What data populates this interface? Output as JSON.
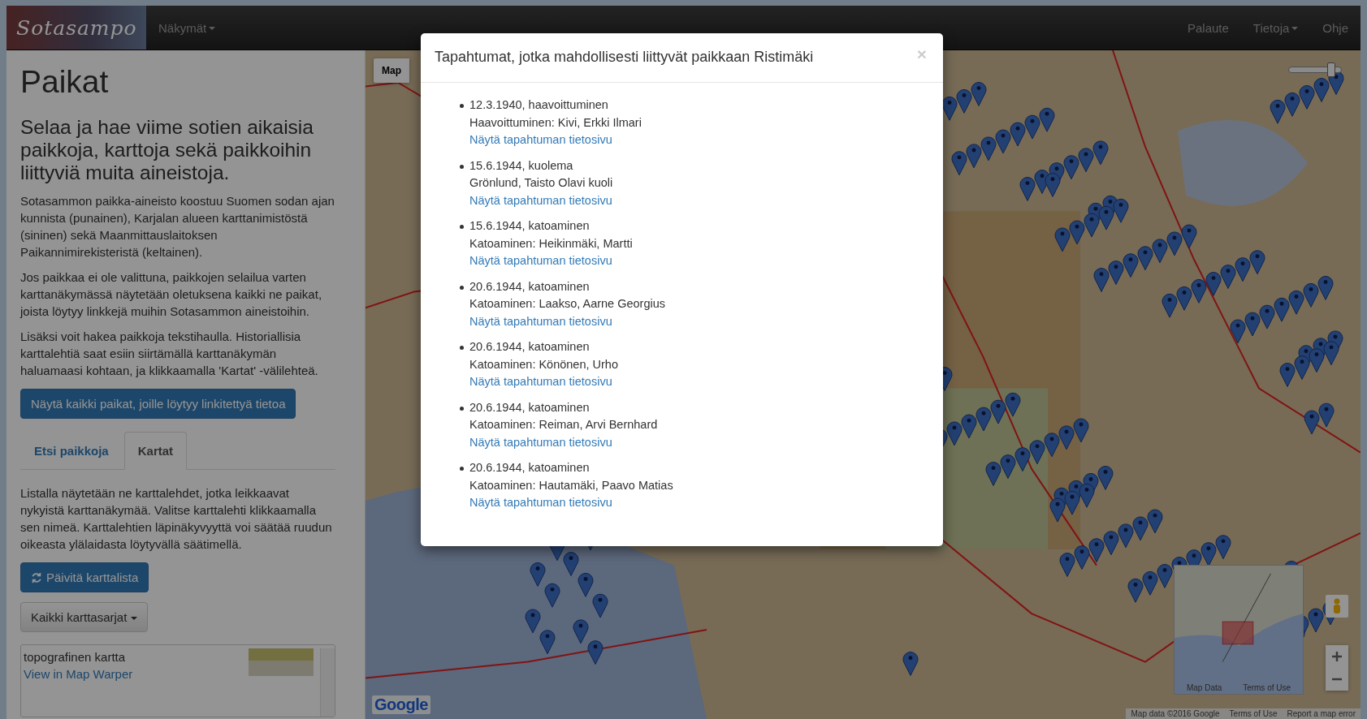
{
  "navbar": {
    "logo": "Sotasampo",
    "menu_left": [
      {
        "label": "Näkymät",
        "dropdown": true
      }
    ],
    "menu_right": [
      {
        "label": "Palaute",
        "dropdown": false
      },
      {
        "label": "Tietoja",
        "dropdown": true
      },
      {
        "label": "Ohje",
        "dropdown": false
      }
    ]
  },
  "sidebar": {
    "title": "Paikat",
    "lead": "Selaa ja hae viime sotien aikaisia paikkoja, karttoja sekä paikkoihin liittyviä muita aineistoja.",
    "paragraphs": [
      "Sotasammon paikka-aineisto koostuu Suomen sodan ajan kunnista (punainen), Karjalan alueen karttanimistöstä (sininen) sekä Maanmittauslaitoksen Paikannimirekisteristä (keltainen).",
      "Jos paikkaa ei ole valittuna, paikkojen selailua varten karttanäkymässä näytetään oletuksena kaikki ne paikat, joista löytyy linkkejä muihin Sotasammon aineistoihin.",
      "Lisäksi voit hakea paikkoja tekstihaulla. Historiallisia karttalehtiä saat esiin siirtämällä karttanäkymän haluamaasi kohtaan, ja klikkaamalla 'Kartat' -välilehteä."
    ],
    "show_all_button": "Näytä kaikki paikat, joille löytyy linkitettyä tietoa",
    "tabs": [
      {
        "label": "Etsi paikkoja",
        "selected": false
      },
      {
        "label": "Kartat",
        "selected": true
      }
    ],
    "tab_text": "Listalla näytetään ne karttalehdet, jotka leikkaavat nykyistä karttanäkymää. Valitse karttalehti klikkaamalla sen nimeä. Karttalehtien läpinäkyvyyttä voi säätää ruudun oikeasta ylälaidasta löytyvällä säätimellä.",
    "refresh_button": "Päivitä karttalista",
    "series_dropdown": "Kaikki karttasarjat",
    "map_list": [
      {
        "title": "topografinen kartta",
        "link": "View in Map Warper"
      }
    ]
  },
  "map": {
    "type_button": "Map",
    "opacity_slider": {
      "level": 0.82
    },
    "logo": "Google",
    "overview_links": [
      "Map Data",
      "Terms of Use"
    ],
    "footer": [
      "Map data ©2016 Google",
      "Terms of Use",
      "Report a map error"
    ]
  },
  "modal": {
    "title": "Tapahtumat, jotka mahdollisesti liittyvät paikkaan Ristimäki",
    "close": "×",
    "events": [
      {
        "heading": "12.3.1940, haavoittuminen",
        "description": "Haavoittuminen: Kivi, Erkki Ilmari",
        "link": "Näytä tapahtuman tietosivu"
      },
      {
        "heading": "15.6.1944, kuolema",
        "description": "Grönlund, Taisto Olavi kuoli",
        "link": "Näytä tapahtuman tietosivu"
      },
      {
        "heading": "15.6.1944, katoaminen",
        "description": "Katoaminen: Heikinmäki, Martti",
        "link": "Näytä tapahtuman tietosivu"
      },
      {
        "heading": "20.6.1944, katoaminen",
        "description": "Katoaminen: Laakso, Aarne Georgius",
        "link": "Näytä tapahtuman tietosivu"
      },
      {
        "heading": "20.6.1944, katoaminen",
        "description": "Katoaminen: Könönen, Urho",
        "link": "Näytä tapahtuman tietosivu"
      },
      {
        "heading": "20.6.1944, katoaminen",
        "description": "Katoaminen: Reiman, Arvi Bernhard",
        "link": "Näytä tapahtuman tietosivu"
      },
      {
        "heading": "20.6.1944, katoaminen",
        "description": "Katoaminen: Hautamäki, Paavo Matias",
        "link": "Näytä tapahtuman tietosivu"
      }
    ]
  }
}
